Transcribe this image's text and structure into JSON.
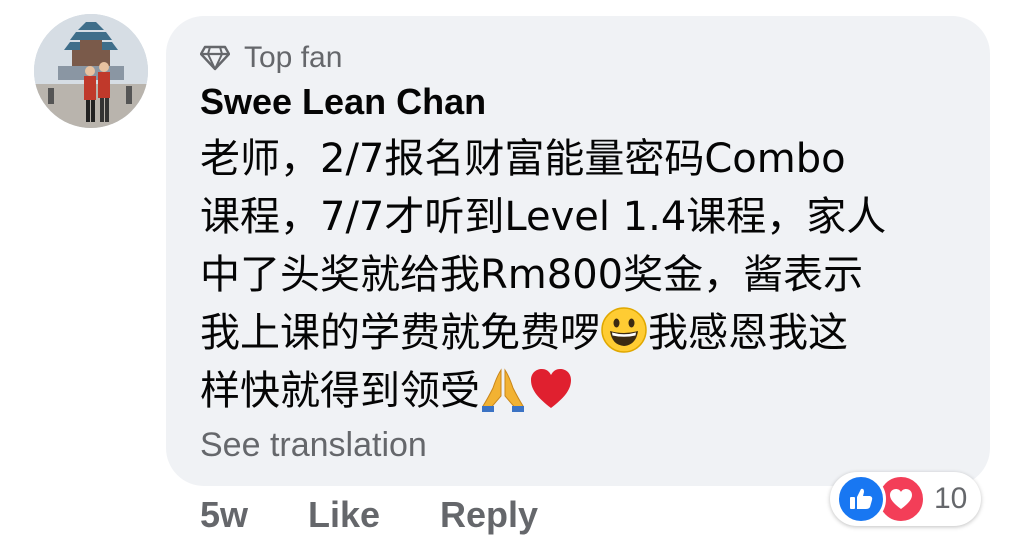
{
  "comment": {
    "badge_label": "Top fan",
    "author": "Swee Lean Chan",
    "lines": {
      "l1": "老师，2/7报名财富能量密码Combo",
      "l2": "课程，7/7才听到Level 1.4课程，家人",
      "l3": "中了头奖就给我Rm800奖金，酱表示",
      "l4a": "我上课的学费就免费啰",
      "l4b": "我感恩我这",
      "l5": "样快就得到领受"
    },
    "see_translation": "See translation"
  },
  "actions": {
    "time": "5w",
    "like_label": "Like",
    "reply_label": "Reply"
  },
  "reactions": {
    "icons": [
      "like-icon",
      "love-icon"
    ],
    "count": "10",
    "colors": {
      "like": "#1877f2",
      "love": "#f33e58"
    }
  },
  "theme": {
    "bubble_bg": "#f0f2f5",
    "secondary_text": "#65676b",
    "primary_text": "#050505"
  }
}
